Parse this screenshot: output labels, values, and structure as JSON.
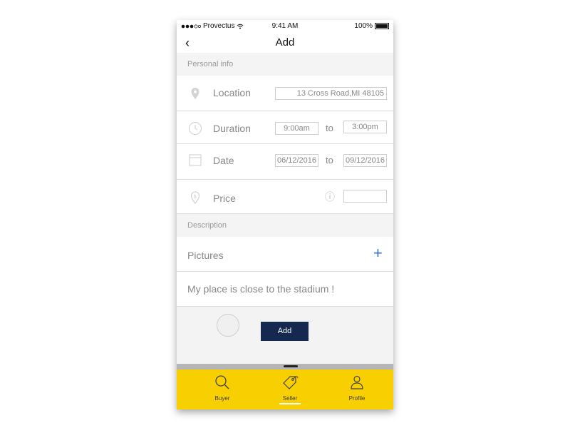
{
  "status_bar": {
    "carrier": "Provectus",
    "time": "9:41 AM",
    "battery": "100%"
  },
  "nav": {
    "back_label": "‹",
    "title": "Add"
  },
  "sections": {
    "personal_info": "Personal info",
    "description": "Description"
  },
  "location": {
    "label": "Location",
    "value": "13 Cross Road,MI 48105"
  },
  "duration": {
    "label": "Duration",
    "from": "9:00am",
    "separator": "to",
    "to": "3:00pm"
  },
  "date": {
    "label": "Date",
    "from": "06/12/2016",
    "separator": "to",
    "to": "09/12/2016"
  },
  "price": {
    "label": "Price",
    "info_icon": "ⓘ",
    "value": ""
  },
  "pictures": {
    "label": "Pictures",
    "add_symbol": "+"
  },
  "description_text": "My place is close to the stadium !",
  "add_button": "Add",
  "tabs": [
    {
      "label": "Buyer",
      "icon": "search-icon",
      "active": false
    },
    {
      "label": "Seller",
      "icon": "tag-icon",
      "active": true
    },
    {
      "label": "Profile",
      "icon": "person-icon",
      "active": false
    }
  ],
  "colors": {
    "tab_bar": "#f8cf00",
    "button": "#142850",
    "plus_accent": "#3d6fd8"
  }
}
